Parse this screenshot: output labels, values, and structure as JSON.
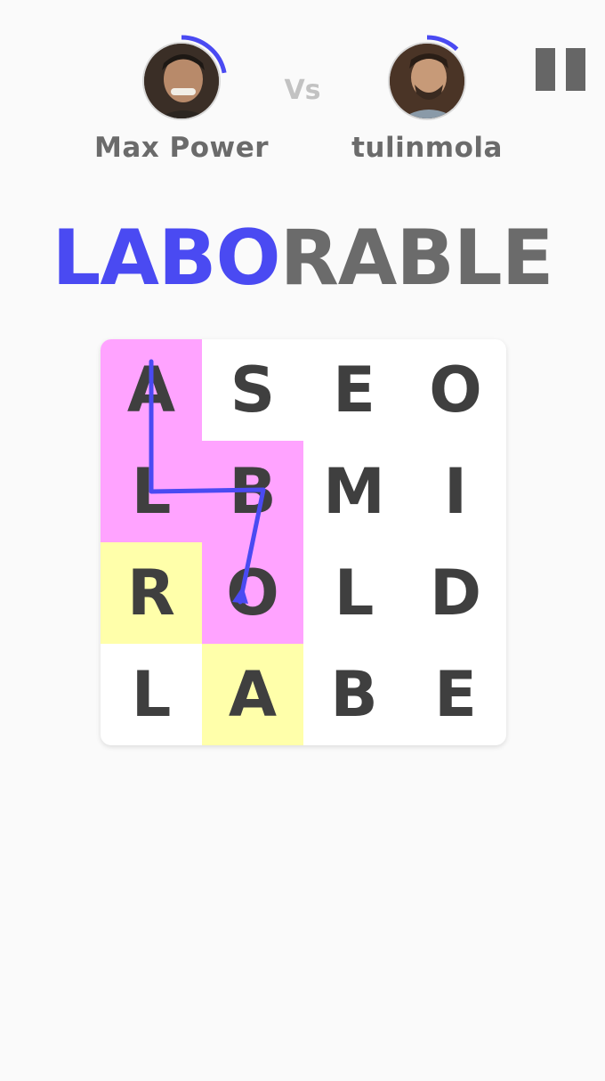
{
  "players": [
    {
      "name": "Max Power",
      "progress": 0.22
    },
    {
      "name": "tulinmola",
      "progress": 0.12
    }
  ],
  "vs_label": "Vs",
  "word": {
    "found": "LABO",
    "rest": "RABLE"
  },
  "board": [
    [
      "A",
      "S",
      "E",
      "O"
    ],
    [
      "L",
      "B",
      "M",
      "I"
    ],
    [
      "R",
      "O",
      "L",
      "D"
    ],
    [
      "L",
      "A",
      "B",
      "E"
    ]
  ],
  "highlighted_path": [
    [
      0,
      0
    ],
    [
      1,
      0
    ],
    [
      1,
      1
    ],
    [
      2,
      1
    ]
  ],
  "hint_cells": [
    [
      2,
      0
    ],
    [
      3,
      1
    ]
  ],
  "colors": {
    "accent": "#4a4af2",
    "path_cell": "#ffa3ff",
    "hint_cell": "#ffffaa",
    "text": "#3f3f3f"
  },
  "icons": {
    "pause": "pause-icon"
  }
}
